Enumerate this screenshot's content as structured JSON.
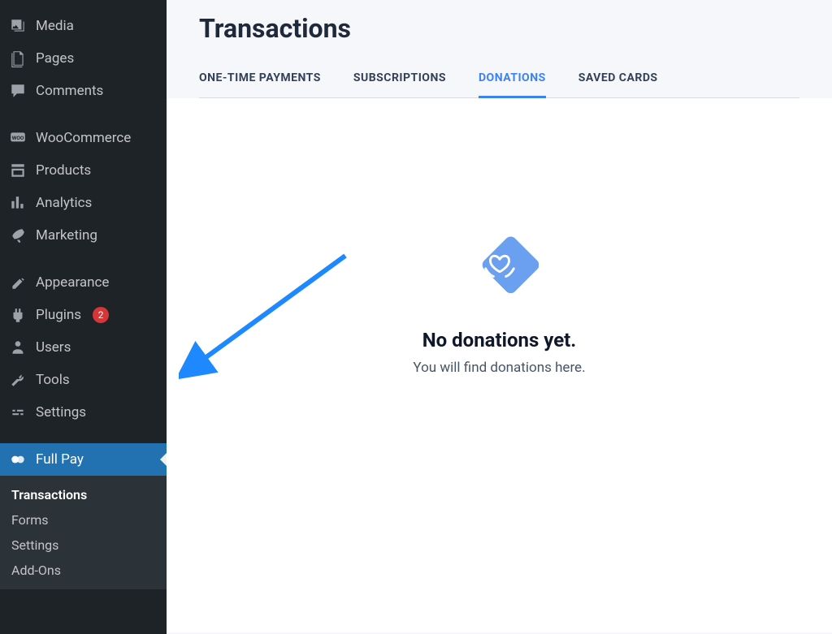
{
  "sidebar": {
    "items": [
      {
        "label": "Media",
        "icon": "media"
      },
      {
        "label": "Pages",
        "icon": "pages"
      },
      {
        "label": "Comments",
        "icon": "comments"
      },
      {
        "label": "WooCommerce",
        "icon": "woo",
        "separator_before": true
      },
      {
        "label": "Products",
        "icon": "products"
      },
      {
        "label": "Analytics",
        "icon": "analytics"
      },
      {
        "label": "Marketing",
        "icon": "marketing"
      },
      {
        "label": "Appearance",
        "icon": "appearance",
        "separator_before": true
      },
      {
        "label": "Plugins",
        "icon": "plugins",
        "badge": "2"
      },
      {
        "label": "Users",
        "icon": "users"
      },
      {
        "label": "Tools",
        "icon": "tools"
      },
      {
        "label": "Settings",
        "icon": "settings"
      },
      {
        "label": "Full Pay",
        "icon": "fullpay",
        "active": true,
        "separator_before": true
      }
    ],
    "submenu": [
      {
        "label": "Transactions",
        "active": true
      },
      {
        "label": "Forms"
      },
      {
        "label": "Settings"
      },
      {
        "label": "Add-Ons"
      }
    ]
  },
  "page": {
    "title": "Transactions"
  },
  "tabs": [
    {
      "label": "ONE-TIME PAYMENTS"
    },
    {
      "label": "SUBSCRIPTIONS"
    },
    {
      "label": "DONATIONS",
      "active": true
    },
    {
      "label": "SAVED CARDS"
    }
  ],
  "empty_state": {
    "title": "No donations yet.",
    "subtitle": "You will find donations here."
  }
}
